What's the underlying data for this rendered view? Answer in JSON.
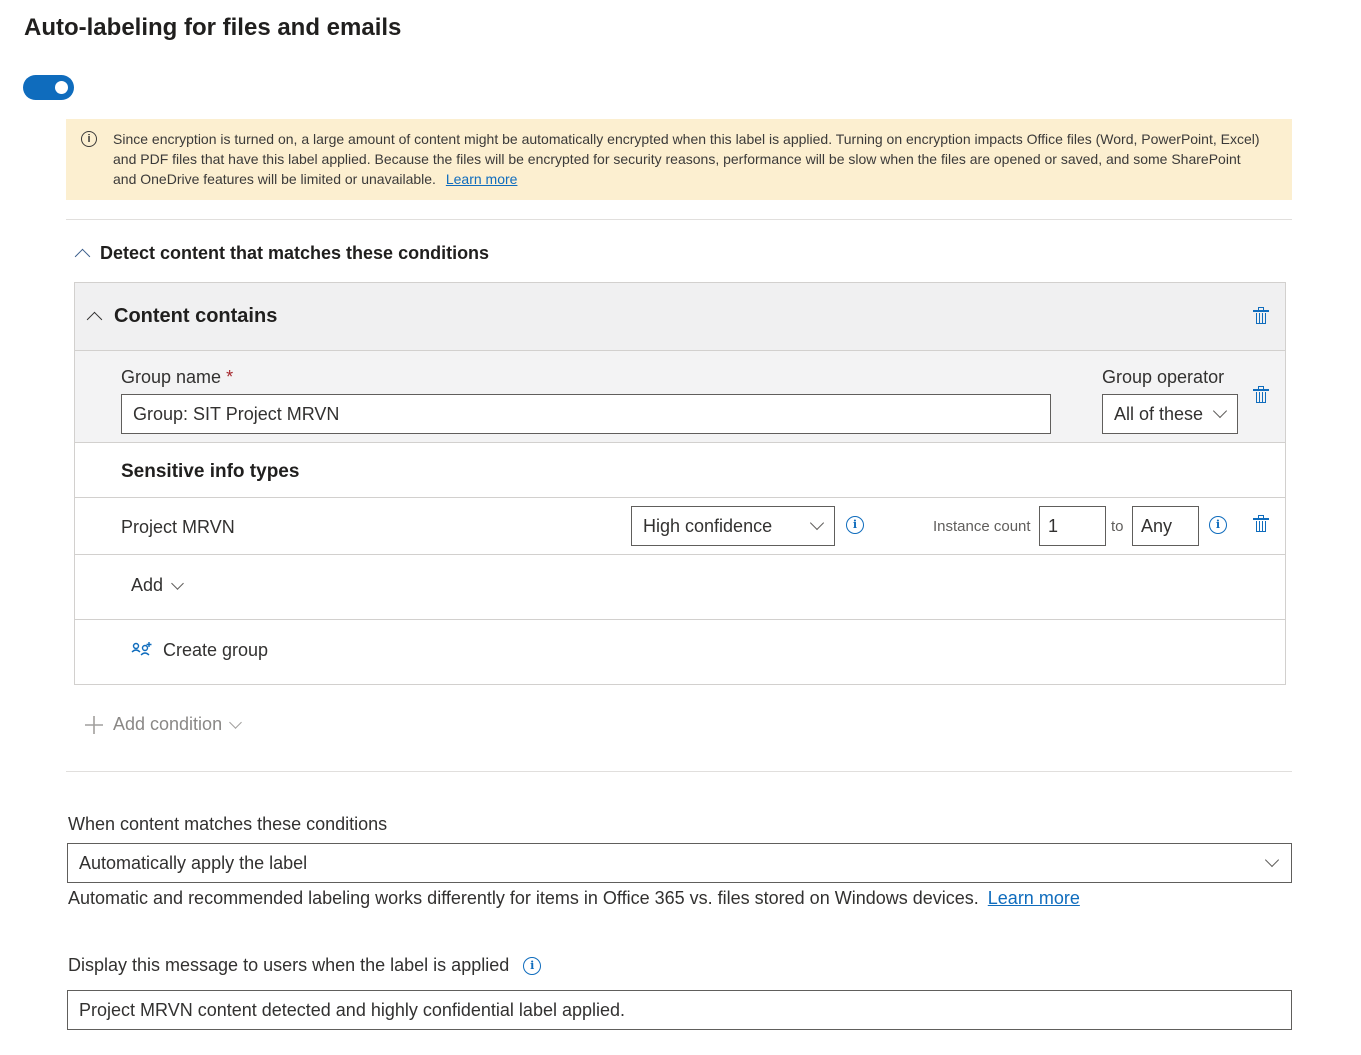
{
  "page": {
    "title": "Auto-labeling for files and emails"
  },
  "toggle": {
    "state": "on"
  },
  "warning": {
    "text": "Since encryption is turned on, a large amount of content might be automatically encrypted when this label is applied. Turning on encryption impacts Office files (Word, PowerPoint, Excel) and PDF files that have this label applied. Because the files will be encrypted for security reasons, performance will be slow when the files are opened or saved, and some SharePoint and OneDrive features will be limited or unavailable.",
    "link": "Learn more"
  },
  "detect": {
    "heading": "Detect content that matches these conditions"
  },
  "content_contains": {
    "title": "Content contains",
    "group_name_label": "Group name",
    "required_marker": "*",
    "group_name_value": "Group: SIT Project MRVN",
    "group_operator_label": "Group operator",
    "group_operator_value": "All of these",
    "sensitive_heading": "Sensitive info types",
    "sit_row": {
      "name": "Project MRVN",
      "confidence": "High confidence",
      "instance_count_label": "Instance count",
      "min": "1",
      "to": "to",
      "max": "Any"
    },
    "add_label": "Add",
    "create_group_label": "Create group"
  },
  "add_condition": {
    "label": "Add condition"
  },
  "when_matches": {
    "label": "When content matches these conditions",
    "value": "Automatically apply the label",
    "note": "Automatic and recommended labeling works differently for items in Office 365 vs. files stored on Windows devices.",
    "link": "Learn more"
  },
  "display_message": {
    "label": "Display this message to users when the label is applied",
    "value": "Project MRVN content detected and highly confidential label applied."
  },
  "colors": {
    "accent": "#0f6cbd",
    "warning_bg": "#fcefd0",
    "header_bg": "#f0f0f1"
  }
}
